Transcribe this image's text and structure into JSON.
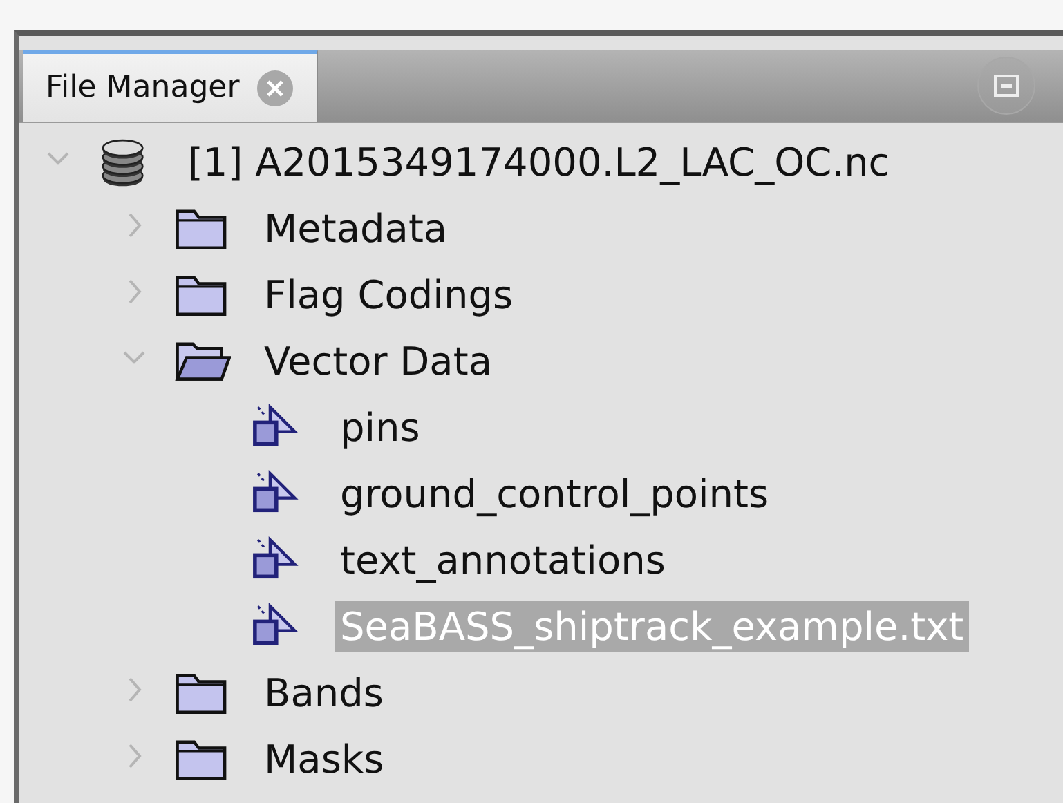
{
  "tabs": [
    {
      "label": "File Manager",
      "selected": true,
      "closable": true
    }
  ],
  "tree": [
    {
      "label": "[1] A2015349174000.L2_LAC_OC.nc",
      "kind": "product",
      "expanded": true,
      "selected": false,
      "children": [
        {
          "label": "Metadata",
          "kind": "folder",
          "expanded": false,
          "selected": false
        },
        {
          "label": "Flag Codings",
          "kind": "folder",
          "expanded": false,
          "selected": false
        },
        {
          "label": "Vector Data",
          "kind": "folder",
          "expanded": true,
          "selected": false,
          "children": [
            {
              "label": "pins",
              "kind": "vector",
              "selected": false
            },
            {
              "label": "ground_control_points",
              "kind": "vector",
              "selected": false
            },
            {
              "label": "text_annotations",
              "kind": "vector",
              "selected": false
            },
            {
              "label": "SeaBASS_shiptrack_example.txt",
              "kind": "vector",
              "selected": true
            }
          ]
        },
        {
          "label": "Bands",
          "kind": "folder",
          "expanded": false,
          "selected": false
        },
        {
          "label": "Masks",
          "kind": "folder",
          "expanded": false,
          "selected": false
        }
      ]
    }
  ]
}
